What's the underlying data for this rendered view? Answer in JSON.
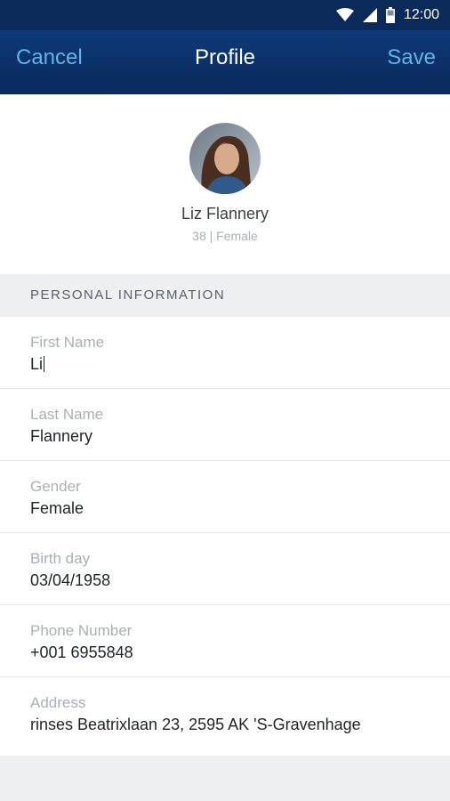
{
  "status_bar": {
    "time": "12:00"
  },
  "app_bar": {
    "cancel_label": "Cancel",
    "title": "Profile",
    "save_label": "Save"
  },
  "profile": {
    "name": "Liz Flannery",
    "meta": "38 | Female"
  },
  "section": {
    "title": "PERSONAL INFORMATION"
  },
  "fields": [
    {
      "label": "First Name",
      "value": "Li"
    },
    {
      "label": "Last Name",
      "value": "Flannery"
    },
    {
      "label": "Gender",
      "value": "Female"
    },
    {
      "label": "Birth day",
      "value": "03/04/1958"
    },
    {
      "label": "Phone Number",
      "value": "+001 6955848"
    },
    {
      "label": "Address",
      "value": "rinses Beatrixlaan 23, 2595 AK  'S-Gravenhage"
    }
  ],
  "colors": {
    "app_bar": "#0b2f66",
    "accent": "#63b3e6",
    "section_bg": "#eef0f2"
  },
  "icons": [
    "wifi-icon",
    "cellular-signal-icon",
    "battery-icon"
  ]
}
